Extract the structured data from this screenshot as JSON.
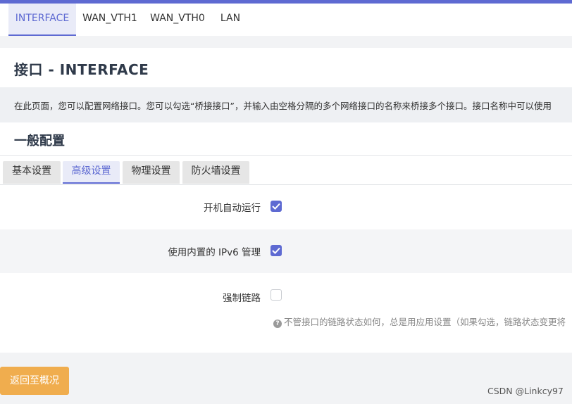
{
  "nav": {
    "tabs": [
      {
        "label": "INTERFACE",
        "active": true
      },
      {
        "label": "WAN_VTH1",
        "active": false
      },
      {
        "label": "WAN_VTH0",
        "active": false
      },
      {
        "label": "LAN",
        "active": false
      }
    ]
  },
  "page": {
    "title": "接口 - INTERFACE",
    "description": "在此页面，您可以配置网络接口。您可以勾选“桥接接口”，并输入由空格分隔的多个网络接口的名称来桥接多个接口。接口名称中可以使用"
  },
  "section": {
    "title": "一般配置",
    "tabs": [
      {
        "label": "基本设置",
        "active": false
      },
      {
        "label": "高级设置",
        "active": true
      },
      {
        "label": "物理设置",
        "active": false
      },
      {
        "label": "防火墙设置",
        "active": false
      }
    ]
  },
  "settings": [
    {
      "label": "开机自动运行",
      "checked": true
    },
    {
      "label": "使用内置的 IPv6 管理",
      "checked": true
    },
    {
      "label": "强制链路",
      "checked": false,
      "hint": "不管接口的链路状态如何，总是用应用设置（如果勾选，链路状态变更将"
    }
  ],
  "hint_icon": "question-icon",
  "buttons": {
    "back": "返回至概况"
  },
  "watermark": "CSDN @Linkcy97",
  "colors": {
    "accent": "#5e6ad2",
    "back_button": "#f0ad4e"
  }
}
